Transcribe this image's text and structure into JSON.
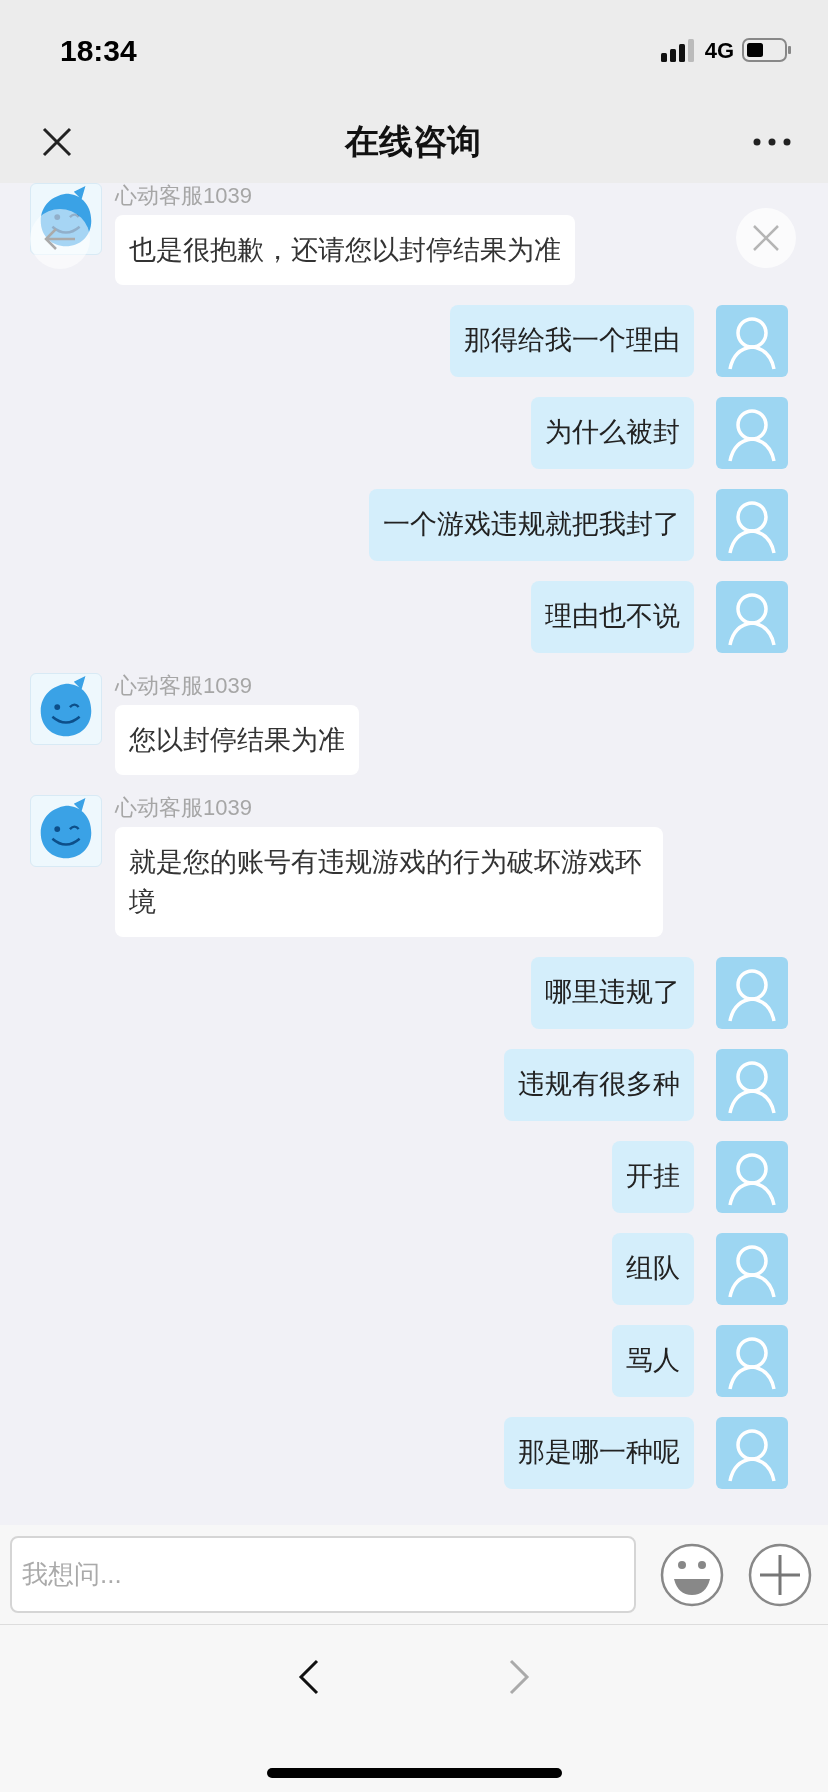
{
  "status_bar": {
    "time": "18:34",
    "network": "4G"
  },
  "header": {
    "title": "在线咨询"
  },
  "messages": [
    {
      "kind": "agent",
      "sender": "心动客服1039",
      "text": "也是很抱歉，还请您以封停结果为准"
    },
    {
      "kind": "user",
      "text": "那得给我一个理由"
    },
    {
      "kind": "user",
      "text": "为什么被封"
    },
    {
      "kind": "user",
      "text": "一个游戏违规就把我封了"
    },
    {
      "kind": "user",
      "text": "理由也不说"
    },
    {
      "kind": "agent",
      "sender": "心动客服1039",
      "text": "您以封停结果为准"
    },
    {
      "kind": "agent",
      "sender": "心动客服1039",
      "text": "就是您的账号有违规游戏的行为破坏游戏环境"
    },
    {
      "kind": "user",
      "text": "哪里违规了"
    },
    {
      "kind": "user",
      "text": "违规有很多种"
    },
    {
      "kind": "user",
      "text": "开挂"
    },
    {
      "kind": "user",
      "text": "组队"
    },
    {
      "kind": "user",
      "text": "骂人"
    },
    {
      "kind": "user",
      "text": "那是哪一种呢"
    }
  ],
  "input": {
    "placeholder": "我想问..."
  },
  "nav": {
    "back_disabled": false,
    "forward_disabled": true
  }
}
